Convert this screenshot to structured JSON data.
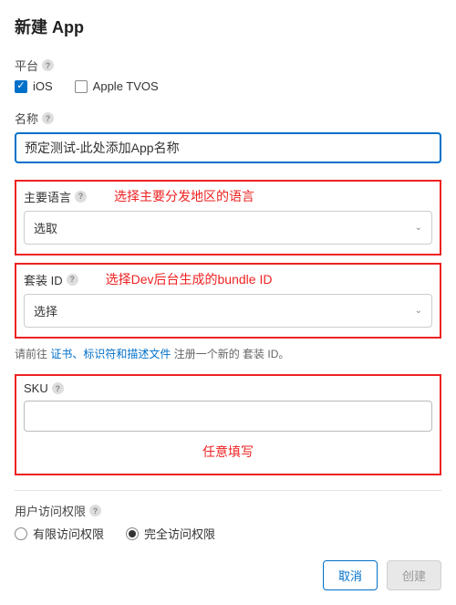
{
  "dialog": {
    "title": "新建 App"
  },
  "platform": {
    "label": "平台",
    "ios": "iOS",
    "tvos": "Apple TVOS"
  },
  "name": {
    "label": "名称",
    "value": "预定测试-此处添加App名称"
  },
  "lang": {
    "label": "主要语言",
    "annotation": "选择主要分发地区的语言",
    "selected": "选取"
  },
  "bundle": {
    "label": "套装 ID",
    "annotation": "选择Dev后台生成的bundle ID",
    "selected": "选择",
    "guide_prefix": "请前往",
    "guide_link": "证书、标识符和描述文件",
    "guide_suffix": "注册一个新的 套装 ID。"
  },
  "sku": {
    "label": "SKU",
    "annotation": "任意填写"
  },
  "access": {
    "label": "用户访问权限",
    "limited": "有限访问权限",
    "full": "完全访问权限"
  },
  "footer": {
    "cancel": "取消",
    "create": "创建"
  }
}
